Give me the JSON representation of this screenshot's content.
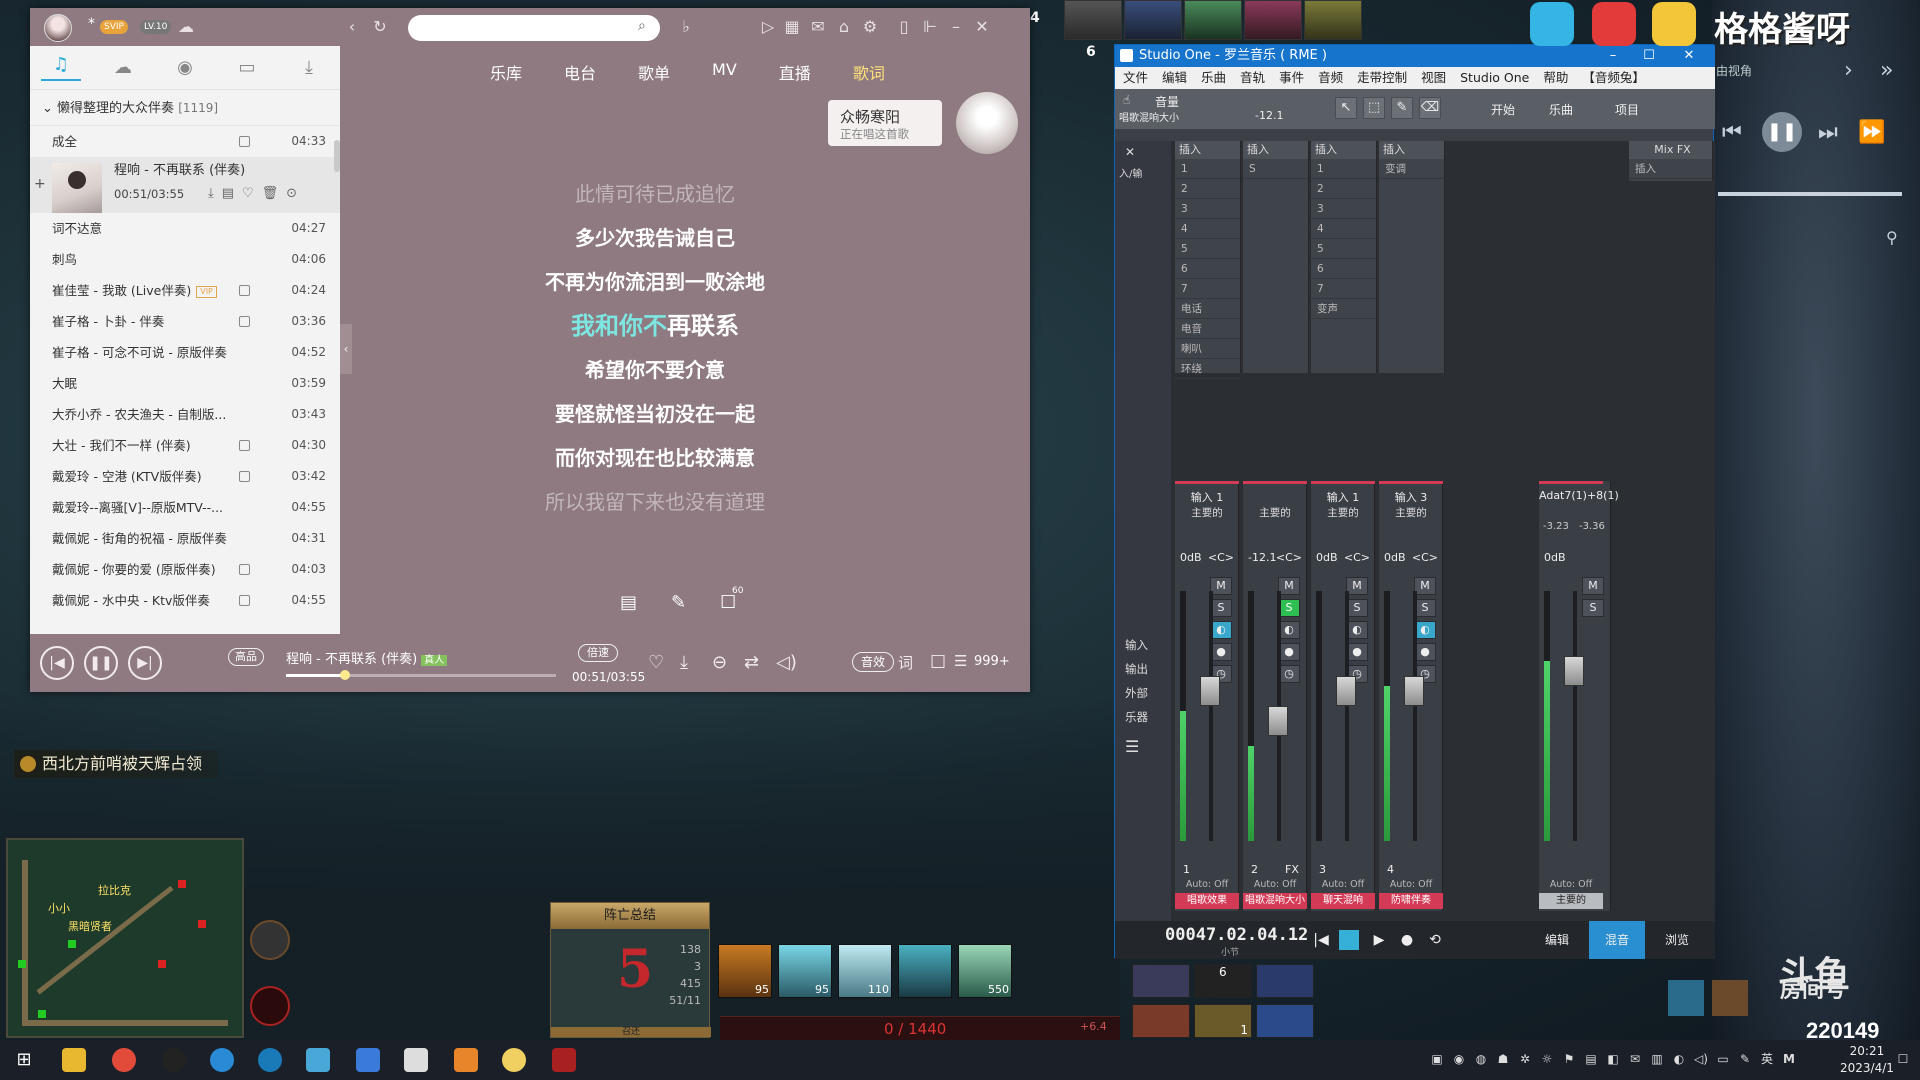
{
  "game": {
    "notice": "西北方前哨被天辉占领",
    "minimap_labels": [
      "拉比克",
      "黑暗贤者",
      "小小"
    ],
    "hero_numbers": [
      "4",
      "6"
    ],
    "death_panel": {
      "title": "阵亡总结",
      "deaths": "5",
      "stats": [
        "138",
        "3",
        "415",
        "51/11"
      ],
      "footer": "召还"
    },
    "ability_levels": [
      "95",
      "95",
      "110",
      "",
      "550"
    ],
    "mana": "0 / 1440",
    "regen": "+6.4",
    "item_counts": [
      "6",
      "1"
    ]
  },
  "player": {
    "level_badge": "LV.10",
    "vip_badge": "SVIP",
    "search": {
      "value": "",
      "placeholder": ""
    },
    "nav_tabs": [
      "乐库",
      "电台",
      "歌单",
      "MV",
      "直播",
      "歌词"
    ],
    "active_nav": "歌词",
    "playlist": {
      "name": "懒得整理的大众伴奏",
      "count": "[1119]"
    },
    "current_track": {
      "title": "程响 - 不再联系 (伴奏)",
      "position": "00:51/03:55"
    },
    "tracks": [
      {
        "title": "成全",
        "duration": "04:33",
        "mv": true
      },
      {
        "title": "词不达意",
        "duration": "04:27",
        "mv": false
      },
      {
        "title": "刺鸟",
        "duration": "04:06",
        "mv": false
      },
      {
        "title": "崔佳莹 - 我敢 (Live伴奏)",
        "duration": "04:24",
        "mv": true,
        "vip": "VIP"
      },
      {
        "title": "崔子格 - 卜卦 - 伴奏",
        "duration": "03:36",
        "mv": true
      },
      {
        "title": "崔子格 - 可念不可说 - 原版伴奏",
        "duration": "04:52",
        "mv": false
      },
      {
        "title": "大眠",
        "duration": "03:59",
        "mv": false
      },
      {
        "title": "大乔小乔 - 农夫渔夫 - 自制版...",
        "duration": "03:43",
        "mv": false
      },
      {
        "title": "大壮 - 我们不一样 (伴奏)",
        "duration": "04:30",
        "mv": true
      },
      {
        "title": "戴爱玲 - 空港 (KTV版伴奏)",
        "duration": "03:42",
        "mv": true
      },
      {
        "title": "戴爱玲--离骚[V]--原版MTV--...",
        "duration": "04:55",
        "mv": false
      },
      {
        "title": "戴佩妮 - 街角的祝福 - 原版伴奏",
        "duration": "04:31",
        "mv": false
      },
      {
        "title": "戴佩妮 - 你要的爱 (原版伴奏)",
        "duration": "04:03",
        "mv": true
      },
      {
        "title": "戴佩妮 - 水中央 - Ktv版伴奏",
        "duration": "04:55",
        "mv": true
      }
    ],
    "singer": {
      "name": "众畅寒阳",
      "status": "正在唱这首歌"
    },
    "lyrics": [
      {
        "text": "此情可待已成追忆",
        "state": "dim"
      },
      {
        "text": "多少次我告诫自己",
        "state": "normal"
      },
      {
        "text": "不再为你流泪到一败涂地",
        "state": "normal"
      },
      {
        "sung": "我和你不",
        "rest": "再联系",
        "state": "active"
      },
      {
        "text": "希望你不要介意",
        "state": "normal"
      },
      {
        "text": "要怪就怪当初没在一起",
        "state": "normal"
      },
      {
        "text": "而你对现在也比较满意",
        "state": "normal"
      },
      {
        "text": "所以我留下来也没有道理",
        "state": "dim"
      }
    ],
    "comment_count": "60",
    "controls": {
      "quality": "高品",
      "now_title": "程响 - 不再联系 (伴奏)",
      "tag": "真人",
      "speed": "倍速",
      "time": "00:51/03:55",
      "progress": 0.217,
      "effect": "音效",
      "lyric_btn": "词",
      "queue": "999+"
    }
  },
  "studio": {
    "title": "Studio One - 罗兰音乐 ( RME )",
    "menu": [
      "文件",
      "编辑",
      "乐曲",
      "音轨",
      "事件",
      "音频",
      "走带控制",
      "视图",
      "Studio One",
      "帮助",
      "【音频兔】"
    ],
    "toolbar": {
      "param_name": "音量",
      "param_sub": "唱歌混响大小",
      "param_value": "-12.1",
      "tabs": [
        "开始",
        "乐曲",
        "项目"
      ]
    },
    "side_labels": [
      "输入",
      "输出",
      "外部",
      "乐器"
    ],
    "side_top": "入/输",
    "insert_head": "插入",
    "mix_fx": "Mix FX",
    "inserts": [
      {
        "slots": [
          "1",
          "2",
          "3",
          "4",
          "5",
          "6",
          "7",
          "电话",
          "电音",
          "喇叭",
          "环绕"
        ]
      },
      {
        "slots": [
          "S"
        ]
      },
      {
        "slots": [
          "1",
          "2",
          "3",
          "4",
          "5",
          "6",
          "7",
          "变声"
        ]
      },
      {
        "slots": [
          "变调"
        ]
      }
    ],
    "channels": [
      {
        "input": "输入 1",
        "bus": "主要的",
        "gain": "0dB",
        "pan": "<C>",
        "num": "1",
        "auto": "Auto: Off",
        "name": "唱歌效果",
        "fader": 0.6,
        "meter": 0.52,
        "solo": false,
        "monitor": true,
        "name_style": "red"
      },
      {
        "input": "",
        "bus": "主要的",
        "gain": "-12.1",
        "pan": "<C>",
        "num": "2",
        "auto": "Auto: Off",
        "name": "唱歌混响大小",
        "fader": 0.48,
        "meter": 0.38,
        "solo": true,
        "monitor": false,
        "name_style": "red",
        "fx": "FX"
      },
      {
        "input": "输入 1",
        "bus": "主要的",
        "gain": "0dB",
        "pan": "<C>",
        "num": "3",
        "auto": "Auto: Off",
        "name": "聊天混响",
        "fader": 0.6,
        "meter": 0.0,
        "solo": false,
        "monitor": false,
        "name_style": "red"
      },
      {
        "input": "输入 3",
        "bus": "主要的",
        "gain": "0dB",
        "pan": "<C>",
        "num": "4",
        "auto": "Auto: Off",
        "name": "防啸伴奏",
        "fader": 0.6,
        "meter": 0.62,
        "solo": false,
        "monitor": true,
        "name_style": "red"
      },
      {
        "input": "Adat7(1)+8(1)",
        "bus": "",
        "gain": "0dB",
        "pan": "",
        "num": "",
        "auto": "Auto: Off",
        "name": "主要的",
        "fader": 0.68,
        "meter": 0.72,
        "solo": false,
        "monitor": false,
        "name_style": "gray",
        "master_vals": [
          "-3.23",
          "-3.36"
        ]
      }
    ],
    "fader_btns": [
      "M",
      "S"
    ],
    "transport": {
      "time": "00047.02.04.12",
      "unit": "小节",
      "pages": [
        "编辑",
        "混音",
        "浏览"
      ],
      "active_page": "混音"
    }
  },
  "overlay": {
    "stream_title": "格格酱呀",
    "right_hint": "由视角",
    "room_label": "房间号",
    "room_num": "220149",
    "platform": "斗鱼"
  },
  "taskbar": {
    "time": "20:21",
    "date": "2023/4/1",
    "ime": "英"
  }
}
